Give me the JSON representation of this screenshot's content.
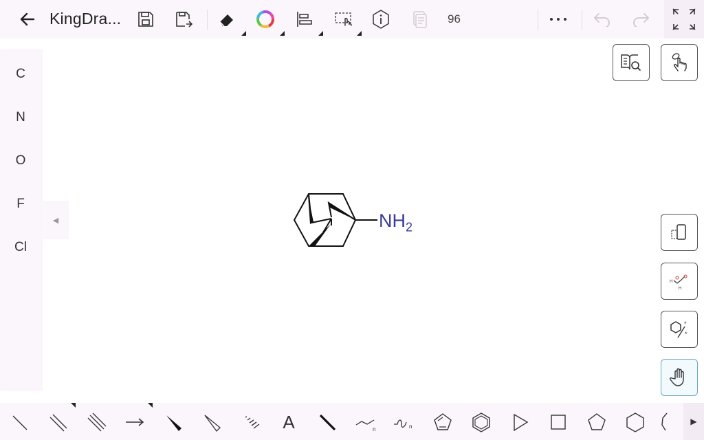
{
  "header": {
    "title": "KingDra...",
    "count": "96"
  },
  "elements": [
    "C",
    "N",
    "O",
    "F",
    "Cl"
  ],
  "left_more": "···",
  "molecule": {
    "group": "NH",
    "subscript": "2",
    "group_color": "#3a3aa0"
  },
  "bottom_tools": {
    "text_tool": "A"
  },
  "colors": {
    "toolbar_bg": "#fbf6fb",
    "active_border": "#6aa6c8"
  },
  "icons": {
    "back": "arrow-left-icon",
    "save": "save-icon",
    "save_as": "save-as-icon",
    "eraser": "eraser-icon",
    "color": "color-wheel-icon",
    "align": "align-left-icon",
    "select": "lasso-select-icon",
    "info": "info-icon",
    "copy": "copy-icon",
    "more": "more-horizontal-icon",
    "undo": "undo-icon",
    "redo": "redo-icon",
    "fullscreen": "fullscreen-icon"
  }
}
